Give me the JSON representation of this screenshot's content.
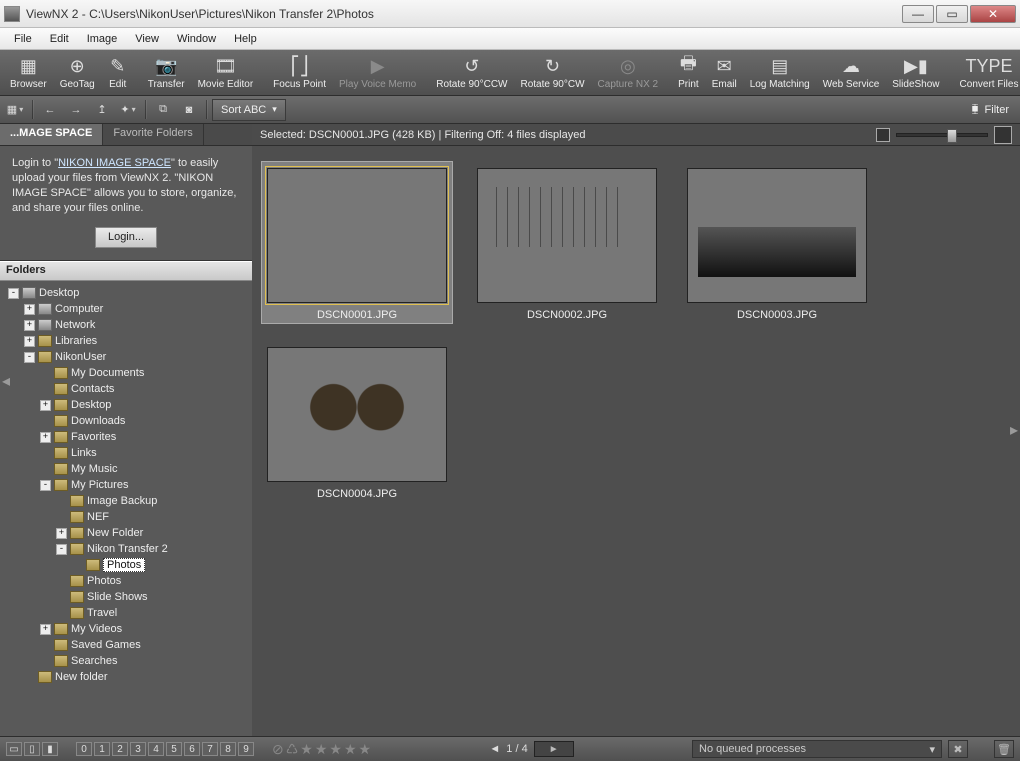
{
  "window": {
    "title": "ViewNX 2 - C:\\Users\\NikonUser\\Pictures\\Nikon Transfer 2\\Photos",
    "min_icon": "—",
    "max_icon": "▭",
    "close_icon": "✕"
  },
  "menu": [
    "File",
    "Edit",
    "Image",
    "View",
    "Window",
    "Help"
  ],
  "toolbar": [
    {
      "id": "browser",
      "label": "Browser"
    },
    {
      "id": "geotag",
      "label": "GeoTag"
    },
    {
      "id": "edit",
      "label": "Edit"
    },
    {
      "id": "sep"
    },
    {
      "id": "transfer",
      "label": "Transfer"
    },
    {
      "id": "movie-editor",
      "label": "Movie Editor"
    },
    {
      "id": "sep"
    },
    {
      "id": "focus-point",
      "label": "Focus Point"
    },
    {
      "id": "play-voice-memo",
      "label": "Play Voice Memo",
      "disabled": true
    },
    {
      "id": "sep"
    },
    {
      "id": "rotate-ccw",
      "label": "Rotate 90°CCW"
    },
    {
      "id": "rotate-cw",
      "label": "Rotate 90°CW"
    },
    {
      "id": "capture-nx2",
      "label": "Capture NX 2",
      "disabled": true
    },
    {
      "id": "sep"
    },
    {
      "id": "print",
      "label": "Print"
    },
    {
      "id": "email",
      "label": "Email"
    },
    {
      "id": "log-matching",
      "label": "Log Matching"
    },
    {
      "id": "web-service",
      "label": "Web Service"
    },
    {
      "id": "slideshow",
      "label": "SlideShow"
    },
    {
      "id": "sep"
    },
    {
      "id": "convert-files",
      "label": "Convert Files"
    }
  ],
  "subbar": {
    "sort_label": "Sort ABC",
    "filter_label": "Filter"
  },
  "left": {
    "tab_active": "...MAGE SPACE",
    "tab_other": "Favorite Folders",
    "promo_prefix": "Login to \"",
    "promo_link": "NIKON IMAGE SPACE",
    "promo_suffix": "\" to easily upload your files from ViewNX 2. \"NIKON IMAGE SPACE\" allows you to store, organize, and share your files online.",
    "login_label": "Login...",
    "folders_header": "Folders"
  },
  "tree": [
    {
      "depth": 0,
      "exp": "-",
      "kind": "drive",
      "label": "Desktop"
    },
    {
      "depth": 1,
      "exp": "+",
      "kind": "drive",
      "label": "Computer"
    },
    {
      "depth": 1,
      "exp": "+",
      "kind": "drive",
      "label": "Network"
    },
    {
      "depth": 1,
      "exp": "+",
      "kind": "folder",
      "label": "Libraries"
    },
    {
      "depth": 1,
      "exp": "-",
      "kind": "folder",
      "label": "NikonUser"
    },
    {
      "depth": 2,
      "exp": " ",
      "kind": "folder",
      "label": "My Documents"
    },
    {
      "depth": 2,
      "exp": " ",
      "kind": "folder",
      "label": "Contacts"
    },
    {
      "depth": 2,
      "exp": "+",
      "kind": "folder",
      "label": "Desktop"
    },
    {
      "depth": 2,
      "exp": " ",
      "kind": "folder",
      "label": "Downloads"
    },
    {
      "depth": 2,
      "exp": "+",
      "kind": "folder",
      "label": "Favorites"
    },
    {
      "depth": 2,
      "exp": " ",
      "kind": "folder",
      "label": "Links"
    },
    {
      "depth": 2,
      "exp": " ",
      "kind": "folder",
      "label": "My Music"
    },
    {
      "depth": 2,
      "exp": "-",
      "kind": "folder",
      "label": "My Pictures"
    },
    {
      "depth": 3,
      "exp": " ",
      "kind": "folder",
      "label": "Image Backup"
    },
    {
      "depth": 3,
      "exp": " ",
      "kind": "folder",
      "label": "NEF"
    },
    {
      "depth": 3,
      "exp": "+",
      "kind": "folder",
      "label": "New Folder"
    },
    {
      "depth": 3,
      "exp": "-",
      "kind": "folder",
      "label": "Nikon Transfer 2"
    },
    {
      "depth": 4,
      "exp": " ",
      "kind": "folder",
      "label": "Photos",
      "selected": true
    },
    {
      "depth": 3,
      "exp": " ",
      "kind": "folder",
      "label": "Photos"
    },
    {
      "depth": 3,
      "exp": " ",
      "kind": "folder",
      "label": "Slide Shows"
    },
    {
      "depth": 3,
      "exp": " ",
      "kind": "folder",
      "label": "Travel"
    },
    {
      "depth": 2,
      "exp": "+",
      "kind": "folder",
      "label": "My Videos"
    },
    {
      "depth": 2,
      "exp": " ",
      "kind": "folder",
      "label": "Saved Games"
    },
    {
      "depth": 2,
      "exp": " ",
      "kind": "folder",
      "label": "Searches"
    },
    {
      "depth": 1,
      "exp": " ",
      "kind": "folder",
      "label": "New folder"
    }
  ],
  "status": {
    "text": "Selected: DSCN0001.JPG (428 KB) | Filtering Off: 4 files displayed"
  },
  "thumbs": [
    {
      "name": "DSCN0001.JPG",
      "selected": true,
      "art": "art-waterfall"
    },
    {
      "name": "DSCN0002.JPG",
      "selected": false,
      "art": "art-beach"
    },
    {
      "name": "DSCN0003.JPG",
      "selected": false,
      "art": "art-night"
    },
    {
      "name": "DSCN0004.JPG",
      "selected": false,
      "art": "art-statues"
    }
  ],
  "footer": {
    "labels": [
      "0",
      "1",
      "2",
      "3",
      "4",
      "5",
      "6",
      "7",
      "8",
      "9"
    ],
    "page": "1 / 4",
    "play": "►",
    "prev": "◄",
    "next": "►",
    "queue": "No queued processes",
    "queue_arrow": "▾",
    "cancel_icon": "✖",
    "trash_icon": "🗑"
  }
}
